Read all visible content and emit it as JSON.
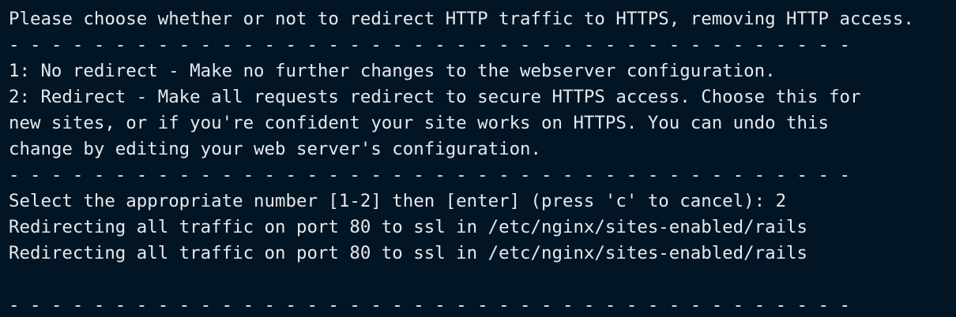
{
  "terminal": {
    "lines": [
      "Please choose whether or not to redirect HTTP traffic to HTTPS, removing HTTP access.",
      "- - - - - - - - - - - - - - - - - - - - - - - - - - - - - - - - - - - - - - - -",
      "1: No redirect - Make no further changes to the webserver configuration.",
      "2: Redirect - Make all requests redirect to secure HTTPS access. Choose this for",
      "new sites, or if you're confident your site works on HTTPS. You can undo this",
      "change by editing your web server's configuration.",
      "- - - - - - - - - - - - - - - - - - - - - - - - - - - - - - - - - - - - - - - -",
      "Select the appropriate number [1-2] then [enter] (press 'c' to cancel): 2",
      "Redirecting all traffic on port 80 to ssl in /etc/nginx/sites-enabled/rails",
      "Redirecting all traffic on port 80 to ssl in /etc/nginx/sites-enabled/rails",
      "",
      "- - - - - - - - - - - - - - - - - - - - - - - - - - - - - - - - - - - - - - - -"
    ]
  },
  "colors": {
    "background": "#021524",
    "foreground": "#e6e9ec"
  }
}
